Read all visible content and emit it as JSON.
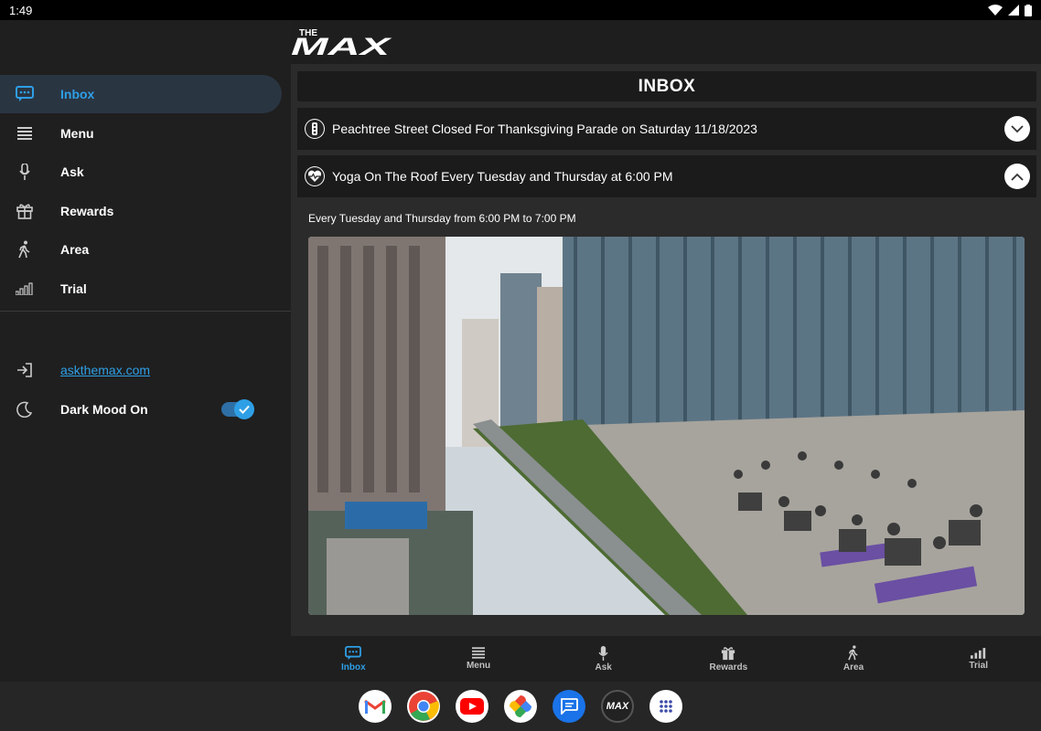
{
  "status_bar": {
    "time": "1:49"
  },
  "brand": {
    "logo_text_top": "THE",
    "logo_text_main": "MAX"
  },
  "drawer": {
    "items": [
      {
        "label": "Inbox",
        "icon": "chat-icon"
      },
      {
        "label": "Menu",
        "icon": "menu-icon"
      },
      {
        "label": "Ask",
        "icon": "mic-icon"
      },
      {
        "label": "Rewards",
        "icon": "gift-icon"
      },
      {
        "label": "Area",
        "icon": "walk-icon"
      },
      {
        "label": "Trial",
        "icon": "signal-icon"
      }
    ],
    "link_label": "askthemax.com",
    "dark_mode_label": "Dark Mood On",
    "dark_mode_on": true
  },
  "inbox": {
    "title": "INBOX",
    "messages": [
      {
        "title": "Peachtree Street Closed For Thanksgiving Parade on Saturday 11/18/2023",
        "expanded": false
      },
      {
        "title": "Yoga On The Roof Every Tuesday and Thursday at 6:00 PM",
        "expanded": true,
        "body": "Every Tuesday and Thursday from 6:00 PM to 7:00 PM"
      }
    ]
  },
  "bottom_nav": {
    "items": [
      {
        "label": "Inbox"
      },
      {
        "label": "Menu"
      },
      {
        "label": "Ask"
      },
      {
        "label": "Rewards"
      },
      {
        "label": "Area"
      },
      {
        "label": "Trial"
      }
    ]
  },
  "taskbar": {
    "apps": [
      "gmail-icon",
      "chrome-icon",
      "youtube-icon",
      "photos-icon",
      "messages-icon",
      "themax-app-icon",
      "app-drawer-icon"
    ],
    "themax_app_label": "MAX"
  },
  "colors": {
    "accent": "#2e9fe6",
    "active_row": "#2a3542",
    "panel": "#1b1b1b"
  }
}
